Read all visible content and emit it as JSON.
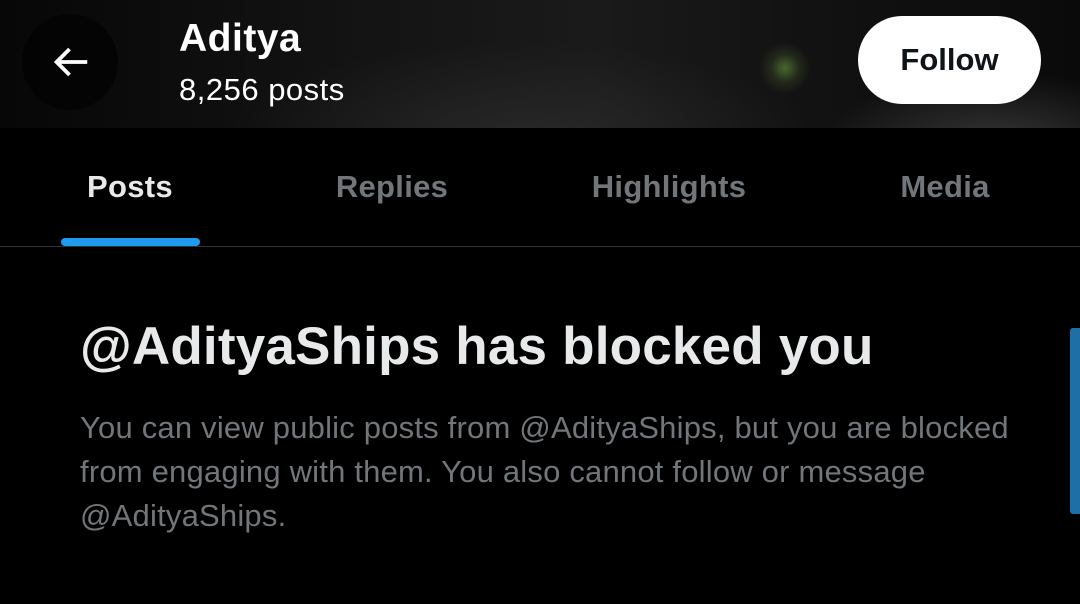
{
  "header": {
    "back_icon": "arrow-left-icon",
    "profile_name": "Aditya",
    "post_count": "8,256 posts",
    "follow_label": "Follow"
  },
  "tabs": [
    {
      "label": "Posts",
      "active": true
    },
    {
      "label": "Replies",
      "active": false
    },
    {
      "label": "Highlights",
      "active": false
    },
    {
      "label": "Media",
      "active": false
    }
  ],
  "notice": {
    "title": "@AdityaShips has blocked you",
    "body": "You can view public posts from @AdityaShips, but you are blocked from engaging with them. You also cannot follow or message @AdityaShips."
  },
  "colors": {
    "background": "#000000",
    "accent": "#1d9bf0",
    "primary_text": "#e7e9ea",
    "secondary_text": "#71767b",
    "follow_button_bg": "#ffffff",
    "follow_button_text": "#0f1419"
  }
}
